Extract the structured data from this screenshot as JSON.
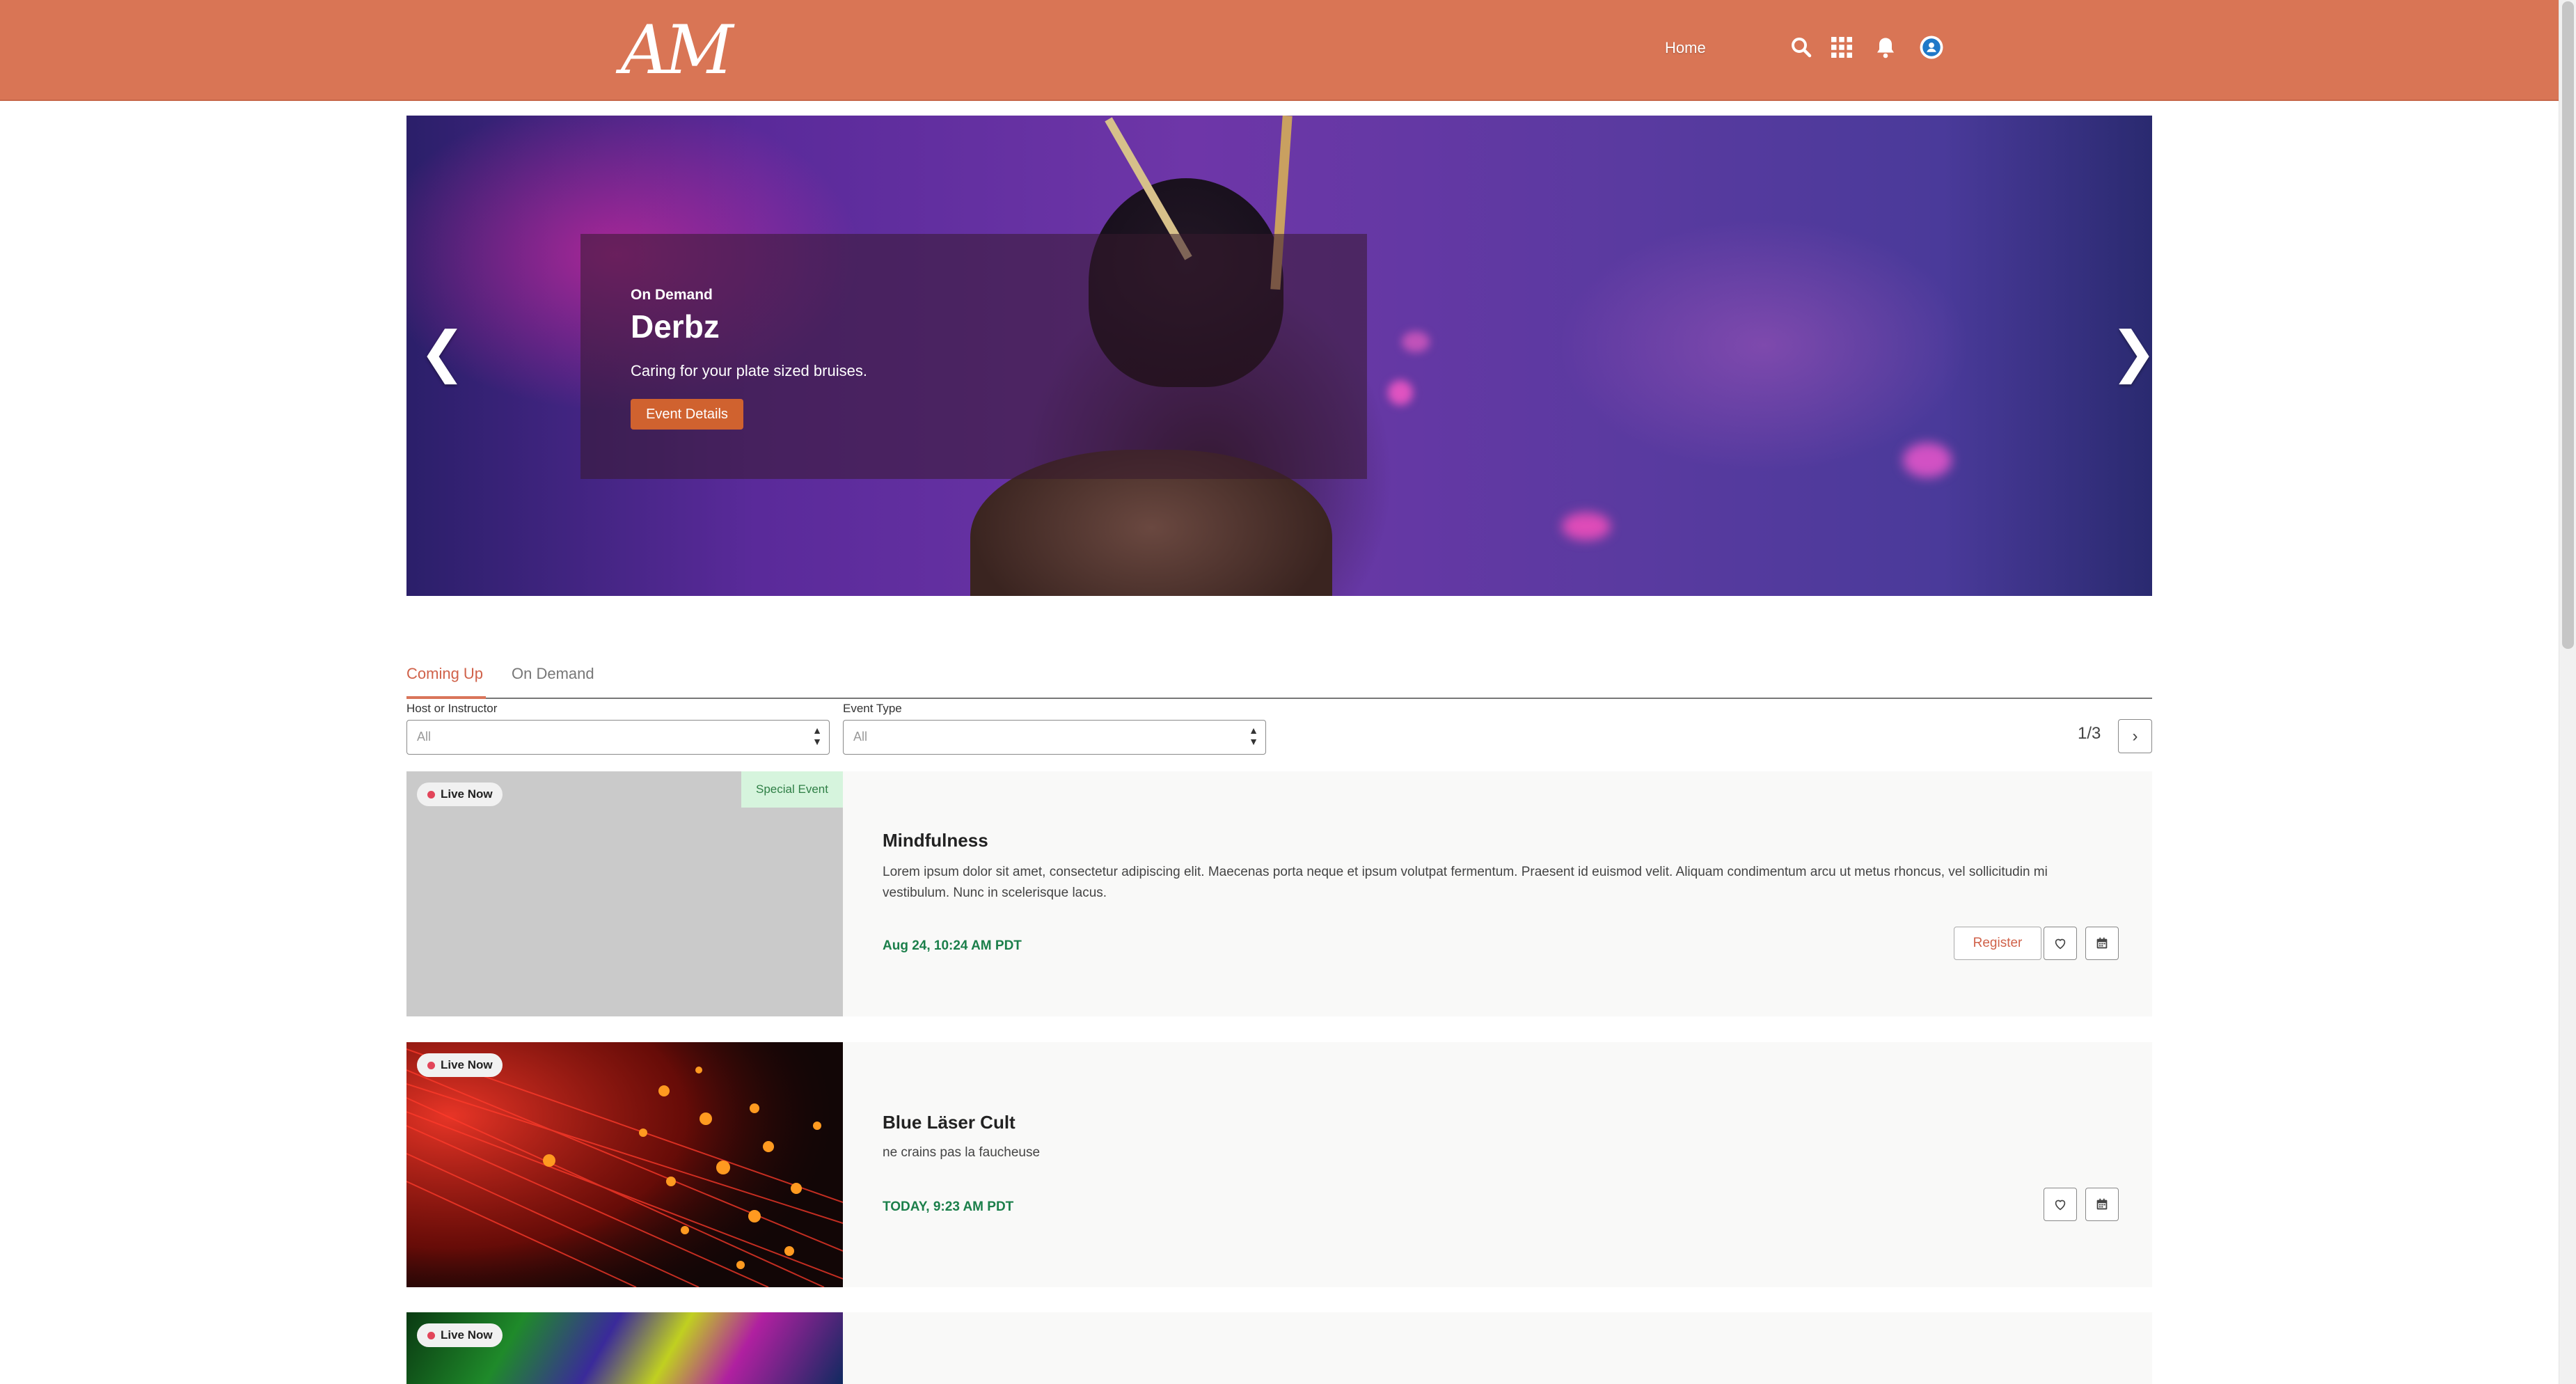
{
  "header": {
    "logo_text": "AM",
    "nav_home": "Home",
    "icons": [
      "search-icon",
      "app-launcher-icon",
      "notifications-icon",
      "user-avatar-icon"
    ],
    "background_color": "#d97555"
  },
  "hero": {
    "category": "On Demand",
    "title": "Derbz",
    "subtitle": "Caring for your plate sized bruises.",
    "button_label": "Event Details",
    "prev_arrow": "❮",
    "next_arrow": "❯",
    "button_color": "#d0622f"
  },
  "tabs": [
    {
      "label": "Coming Up",
      "active": true
    },
    {
      "label": "On Demand",
      "active": false
    }
  ],
  "filters": {
    "host": {
      "label": "Host or Instructor",
      "value": "All"
    },
    "type": {
      "label": "Event Type",
      "value": "All"
    }
  },
  "pagination": {
    "text": "1/3",
    "next_icon": "chevron-right-icon"
  },
  "events": [
    {
      "badge": "Live Now",
      "special": "Special Event",
      "title": "Mindfulness",
      "description": "Lorem ipsum dolor sit amet, consectetur adipiscing elit. Maecenas porta neque et ipsum volutpat fermentum. Praesent id euismod velit. Aliquam condimentum arcu ut metus rhoncus, vel sollicitudin mi vestibulum. Nunc in scelerisque lacus.",
      "date": "Aug 24, 10:24 AM PDT",
      "register_label": "Register"
    },
    {
      "badge": "Live Now",
      "title": "Blue Läser Cult",
      "description": "ne crains pas la faucheuse",
      "date": "TODAY, 9:23 AM PDT"
    },
    {
      "badge": "Live Now"
    }
  ],
  "colors": {
    "accent": "#d9755a",
    "date_green": "#1b7f4a",
    "live_dot": "#e2455a",
    "special_bg": "#d6f4dd"
  }
}
